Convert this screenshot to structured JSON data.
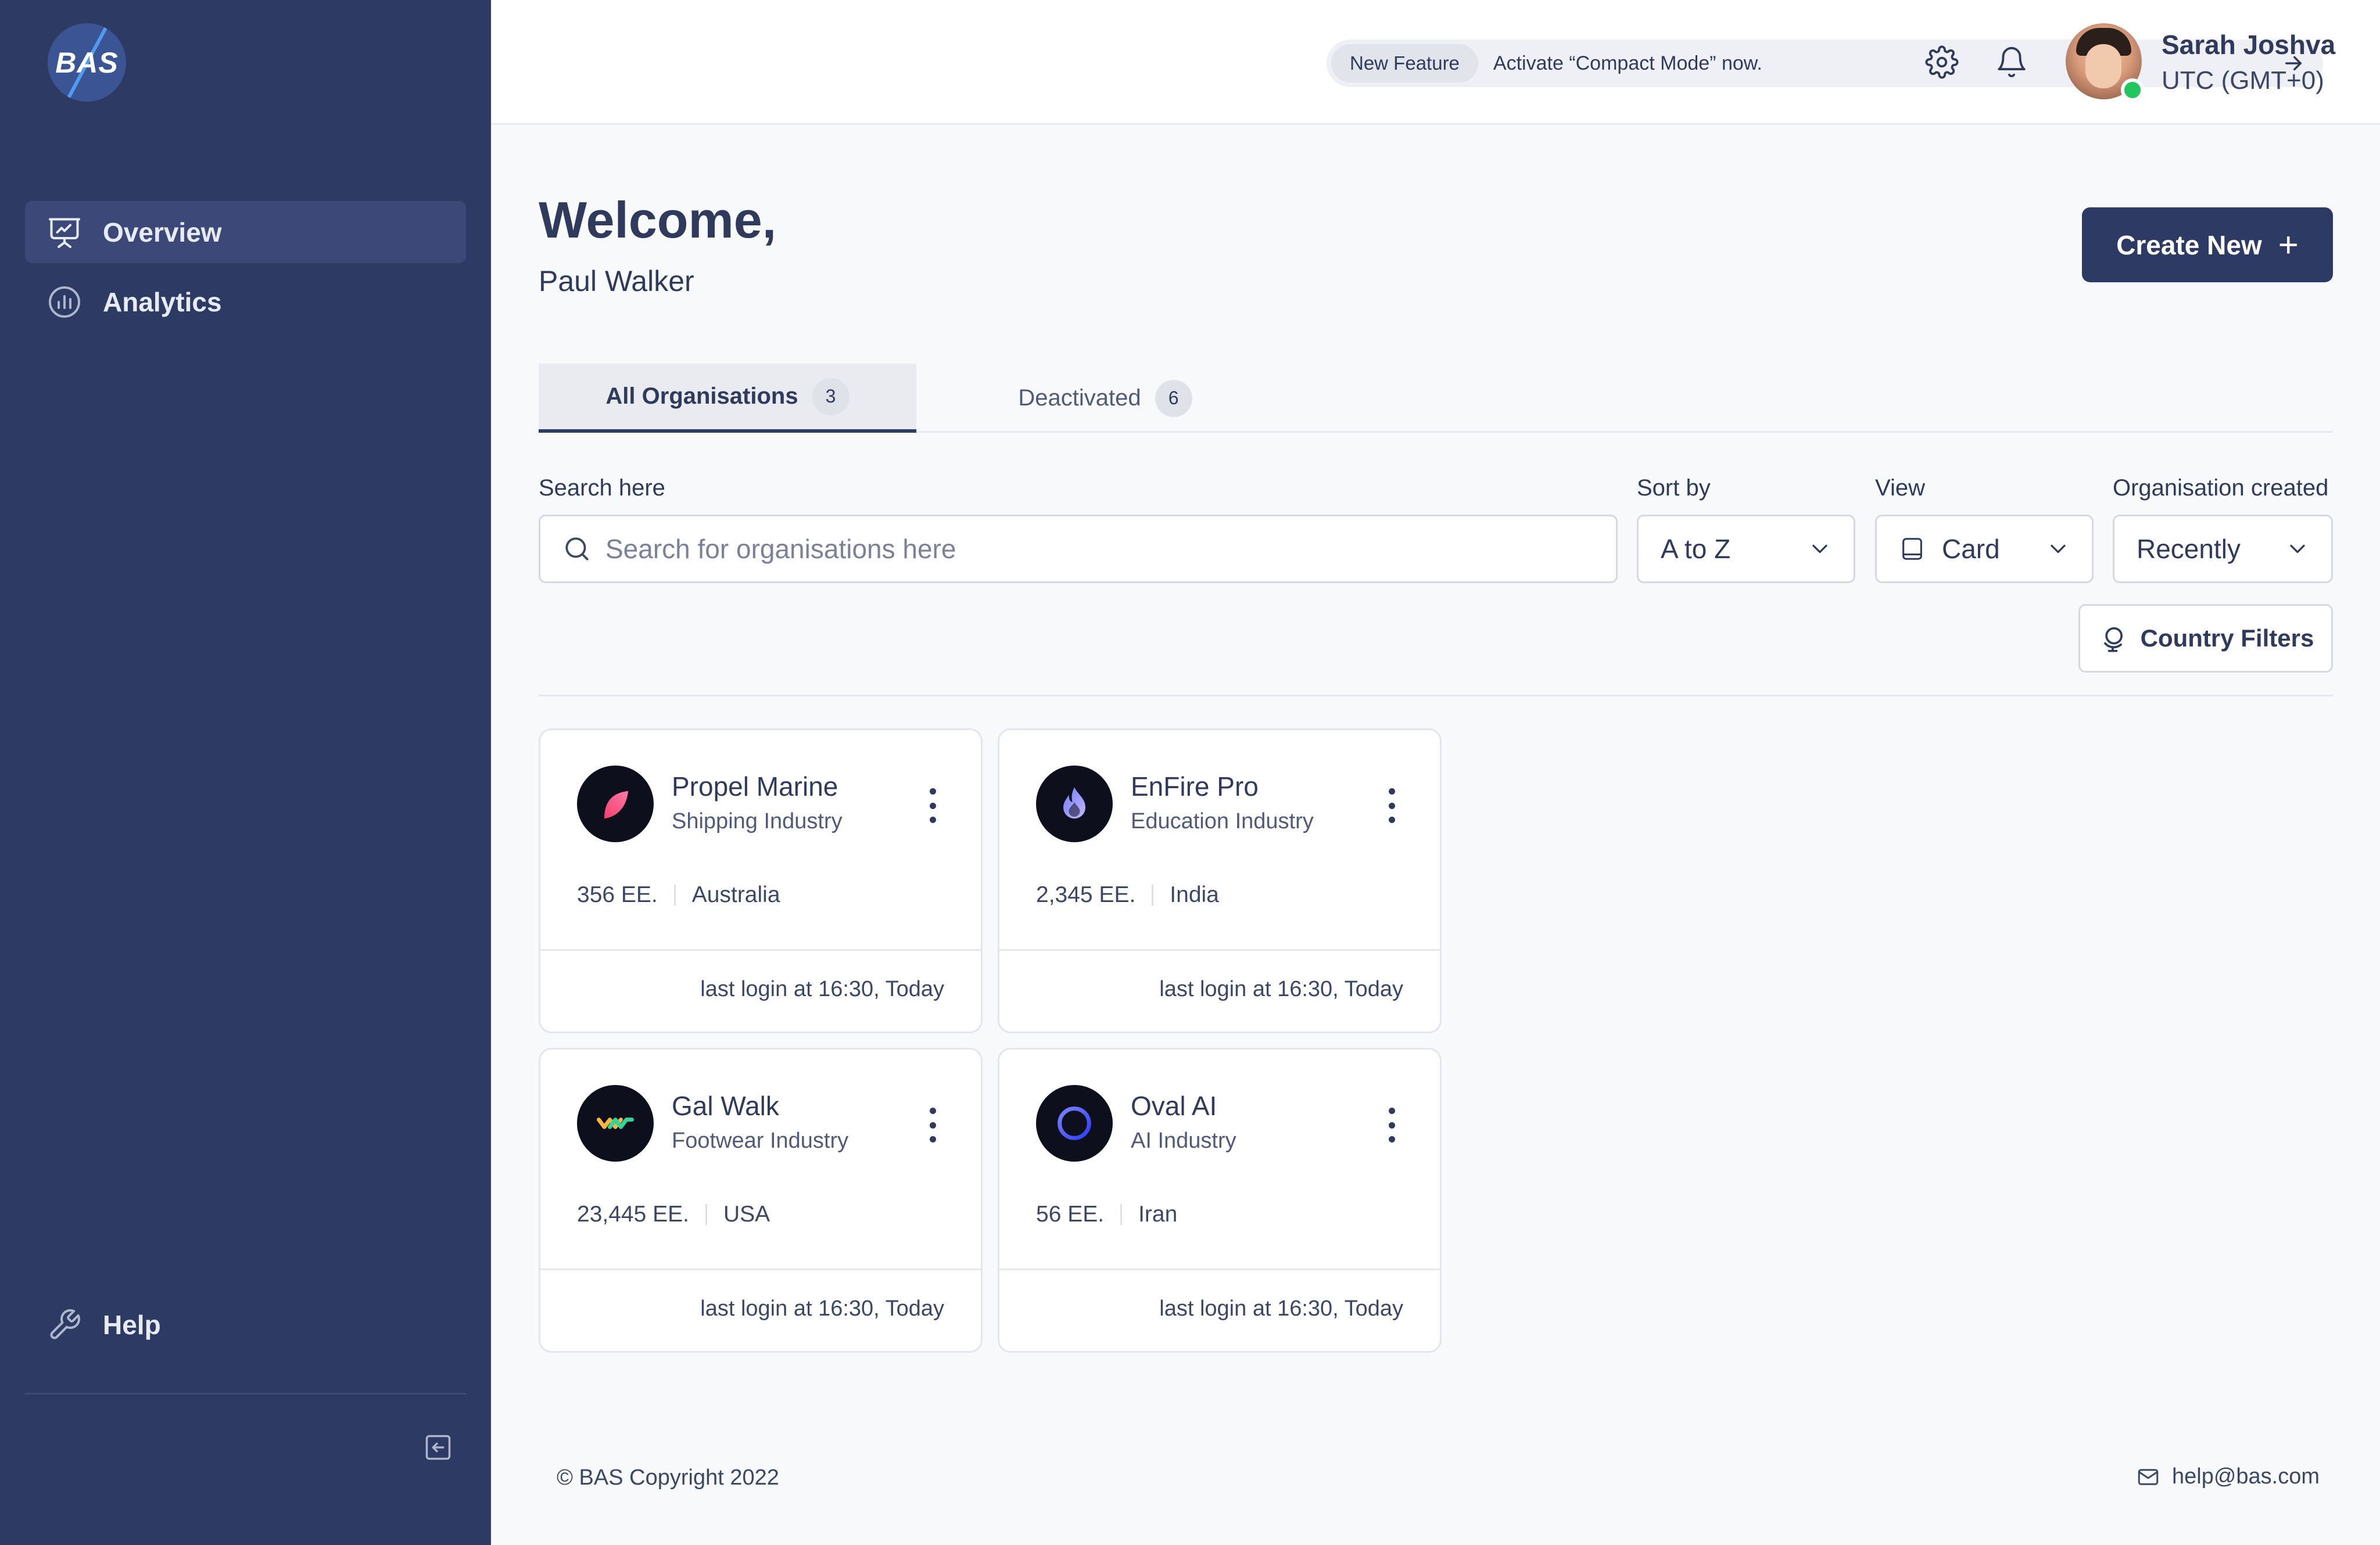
{
  "brand": {
    "logo_text": "BAS"
  },
  "sidebar": {
    "items": [
      {
        "label": "Overview",
        "icon": "presentation-board-icon",
        "active": true
      },
      {
        "label": "Analytics",
        "icon": "chart-circle-icon",
        "active": false
      }
    ],
    "help_label": "Help",
    "help_icon": "wrench-icon",
    "collapse_icon": "collapse-sidebar-icon"
  },
  "header": {
    "feature_badge": "New Feature",
    "feature_text": "Activate “Compact Mode” now.",
    "user": {
      "name": "Sarah Joshva",
      "timezone": "UTC (GMT+0)",
      "status_color": "#22c55e"
    }
  },
  "main": {
    "welcome": "Welcome,",
    "user_name": "Paul Walker",
    "create_label": "Create New",
    "tabs": [
      {
        "label": "All Organisations",
        "count": "3",
        "active": true
      },
      {
        "label": "Deactivated",
        "count": "6",
        "active": false
      }
    ],
    "filters": {
      "search_label": "Search here",
      "search_placeholder": "Search for organisations here",
      "sort_label": "Sort by",
      "sort_value": "A to Z",
      "view_label": "View",
      "view_value": "Card",
      "created_label": "Organisation created",
      "created_value": "Recently",
      "country_label": "Country Filters"
    },
    "organisations": [
      {
        "name": "Propel Marine",
        "industry": "Shipping Industry",
        "employees": "356 EE.",
        "country": "Australia",
        "last_login": "last login at 16:30, Today"
      },
      {
        "name": "EnFire Pro",
        "industry": "Education Industry",
        "employees": "2,345 EE.",
        "country": "India",
        "last_login": "last login at 16:30, Today"
      },
      {
        "name": "Gal Walk",
        "industry": "Footwear Industry",
        "employees": "23,445 EE.",
        "country": "USA",
        "last_login": "last login at 16:30, Today"
      },
      {
        "name": "Oval AI",
        "industry": "AI Industry",
        "employees": "56 EE.",
        "country": "Iran",
        "last_login": "last login at 16:30, Today"
      }
    ]
  },
  "footer": {
    "copyright": "© BAS Copyright 2022",
    "email": "help@bas.com"
  },
  "colors": {
    "sidebar": "#2d3a63",
    "accent": "#2d3a63",
    "background": "#f8f9fb"
  }
}
